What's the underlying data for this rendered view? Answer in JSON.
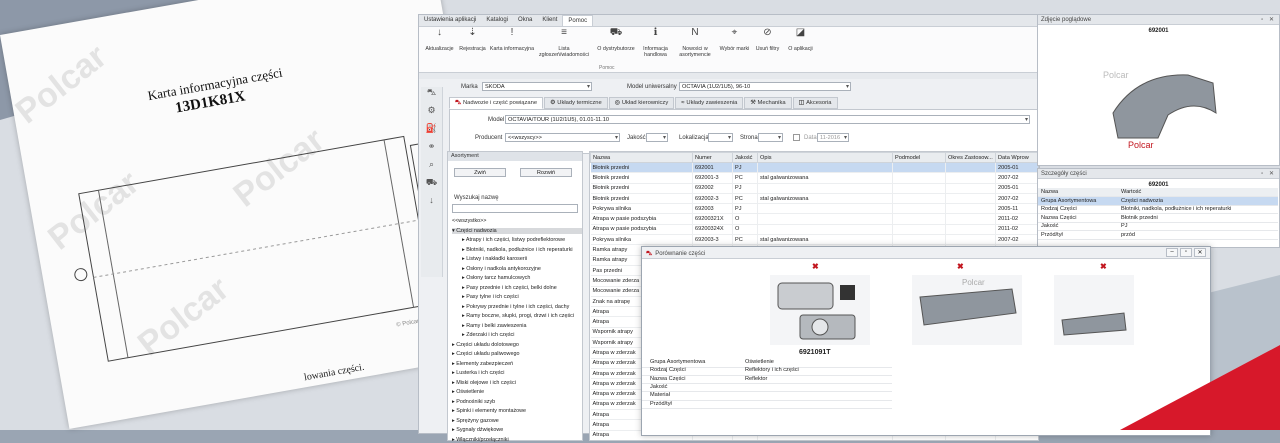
{
  "paper": {
    "title": "Karta informacyjna części",
    "code": "13D1K81X",
    "watermark": "Polcar",
    "footer": "lowania części.",
    "copyright": "© Polcar PPI"
  },
  "menu": [
    "Ustawienia aplikacji",
    "Katalogi",
    "Okna",
    "Klient",
    "Pomoc"
  ],
  "menu_active_index": 4,
  "ribbon": {
    "buttons": [
      {
        "icon": "↓",
        "label": "Aktualizacje"
      },
      {
        "icon": "⇣",
        "label": "Rejestracja"
      },
      {
        "icon": "!",
        "label": "Karta informacyjna"
      },
      {
        "icon": "≡",
        "label": "Lista zgłoszeń/wiadomości"
      },
      {
        "icon": "⛟",
        "label": "O dystrybutorze"
      },
      {
        "icon": "ℹ",
        "label": "Informacja handlowa"
      },
      {
        "icon": "N",
        "label": "Nowości w asortymencie"
      },
      {
        "icon": "⌖",
        "label": "Wybór marki"
      },
      {
        "icon": "⊘",
        "label": "Usuń filtry"
      },
      {
        "icon": "◪",
        "label": "O aplikacji"
      }
    ],
    "group": "Pomoc"
  },
  "filters": {
    "marka_label": "Marka",
    "marka_value": "SKODA",
    "model_label": "Model uniwersalny",
    "model_value": "OCTAVIA (1U2/1U5), 96-10"
  },
  "tabs": [
    {
      "icon": "⛍",
      "label": "Nadwozie i część powiązane"
    },
    {
      "icon": "⚙",
      "label": "Układy termiczne"
    },
    {
      "icon": "◎",
      "label": "Układ kierowniczy"
    },
    {
      "icon": "≈",
      "label": "Układy zawieszenia"
    },
    {
      "icon": "⚒",
      "label": "Mechanika"
    },
    {
      "icon": "◫",
      "label": "Akcesoria"
    }
  ],
  "panel": {
    "model_label": "Model",
    "model_value": "OCTAVIA/TOUR (1U2/1U5), 01.01-11.10",
    "producent_label": "Producent",
    "producent_value": "<<wszyscy>>",
    "jakosc_label": "Jakość",
    "lokalizacja_label": "Lokalizacja",
    "strona_label": "Strona",
    "data_label": "Data",
    "data_value": "11-2016"
  },
  "tree": {
    "header": "Asortyment",
    "expand": "Zwiń",
    "collapse": "Rozwiń",
    "search_label": "Wyszukaj nazwę",
    "nodes": [
      "<<wszystko>>",
      "Części nadwozia",
      "Atrapy i ich części, listwy podreflektorowe",
      "Błotniki, nadkola, podłużnice i ich reperaturki",
      "Listwy i nakładki karoserii",
      "Osłony i nadkola antykorozyjne",
      "Osłony tarcz hamulcowych",
      "Pasy przednie i ich części, belki dolne",
      "Pasy tylne i ich części",
      "Pokrywy przednie i tylne i ich części, dachy",
      "Ramy boczne, słupki, progi, drzwi i ich części",
      "Ramy i belki zawieszenia",
      "Zderzaki i ich części",
      "Części układu dolotowego",
      "Części układu paliwowego",
      "Elementy zabezpieczeń",
      "Lusterka i ich części",
      "Miski olejowe i ich części",
      "Oświetlenie",
      "Podnośniki szyb",
      "Spinki i elementy montażowe",
      "Sprężyny gazowe",
      "Sygnały dźwiękowe",
      "Włączniki/przełączniki"
    ]
  },
  "grid": {
    "columns": [
      "Nazwa",
      "Numer",
      "Jakość",
      "Opis",
      "Podmodel",
      "Okres Zastosow...",
      "Data Wprow"
    ],
    "rows": [
      [
        "Błotnik przedni",
        "692001",
        "PJ",
        "",
        "",
        "",
        "2005-01"
      ],
      [
        "Błotnik przedni",
        "692001-3",
        "PC",
        "stal galwanizowana",
        "",
        "",
        "2007-02"
      ],
      [
        "Błotnik przedni",
        "692002",
        "PJ",
        "",
        "",
        "",
        "2005-01"
      ],
      [
        "Błotnik przedni",
        "692002-3",
        "PC",
        "stal galwanizowana",
        "",
        "",
        "2007-02"
      ],
      [
        "Pokrywa silnika",
        "692003",
        "PJ",
        "",
        "",
        "",
        "2005-11"
      ],
      [
        "Atrapa w pasie podszybia",
        "69200321X",
        "O",
        "",
        "",
        "",
        "2011-02"
      ],
      [
        "Atrapa w pasie podszybia",
        "69200324X",
        "O",
        "",
        "",
        "",
        "2011-02"
      ],
      [
        "Pokrywa silnika",
        "692003-3",
        "PC",
        "stal galwanizowana",
        "",
        "",
        "2007-02"
      ],
      [
        "Ramka atrapy",
        "",
        "",
        "",
        "",
        "",
        ""
      ],
      [
        "Ramka atrapy",
        "",
        "",
        "",
        "",
        "",
        ""
      ],
      [
        "Pas przedni",
        "",
        "",
        "",
        "",
        "",
        ""
      ],
      [
        "Mocowanie zderza",
        "",
        "",
        "",
        "",
        "",
        ""
      ],
      [
        "Mocowanie zderza",
        "",
        "",
        "",
        "",
        "",
        ""
      ],
      [
        "Znak na atrapę",
        "",
        "",
        "",
        "",
        "",
        ""
      ],
      [
        "Atrapa",
        "",
        "",
        "",
        "",
        "",
        ""
      ],
      [
        "Atrapa",
        "",
        "",
        "",
        "",
        "",
        ""
      ],
      [
        "Wspornik atrapy",
        "",
        "",
        "",
        "",
        "",
        ""
      ],
      [
        "Wspornik atrapy",
        "",
        "",
        "",
        "",
        "",
        ""
      ],
      [
        "Atrapa w zderzak",
        "",
        "",
        "",
        "",
        "",
        ""
      ],
      [
        "Atrapa w zderzak",
        "",
        "",
        "",
        "",
        "",
        ""
      ],
      [
        "Atrapa w zderzak",
        "",
        "",
        "",
        "",
        "",
        ""
      ],
      [
        "Atrapa w zderzak",
        "",
        "",
        "",
        "",
        "",
        ""
      ],
      [
        "Atrapa w zderzak",
        "",
        "",
        "",
        "",
        "",
        ""
      ],
      [
        "Atrapa w zderzak",
        "",
        "",
        "",
        "",
        "",
        ""
      ],
      [
        "Atrapa",
        "",
        "",
        "",
        "",
        "",
        ""
      ],
      [
        "Atrapa",
        "",
        "",
        "",
        "",
        "",
        ""
      ],
      [
        "Atrapa",
        "",
        "",
        "",
        "",
        "",
        ""
      ]
    ]
  },
  "photo_panel": {
    "title": "Zdjęcie poglądowe",
    "part": "692001"
  },
  "details_panel": {
    "title": "Szczegóły części",
    "part": "692001",
    "head": [
      "Nazwa",
      "Wartość"
    ],
    "rows": [
      [
        "Grupa Asortymentowa",
        "Części nadwozia"
      ],
      [
        "Rodzaj Części",
        "Błotniki, nadkola, podłużnice i ich reperaturki"
      ],
      [
        "Nazwa Części",
        "Błotnik przedni"
      ],
      [
        "Jakość",
        "PJ"
      ],
      [
        "Przód/tył",
        "przód"
      ]
    ]
  },
  "compare": {
    "title": "Porównanie części",
    "code": "6921091T",
    "rows": [
      [
        "Grupa Asortymentowa",
        "Oświetlenie"
      ],
      [
        "Rodzaj Części",
        "Reflektory i ich części"
      ],
      [
        "Nazwa Części",
        "Reflektor"
      ],
      [
        "Jakość",
        ""
      ],
      [
        "Materiał",
        ""
      ],
      [
        "Przód/tył",
        ""
      ]
    ]
  }
}
